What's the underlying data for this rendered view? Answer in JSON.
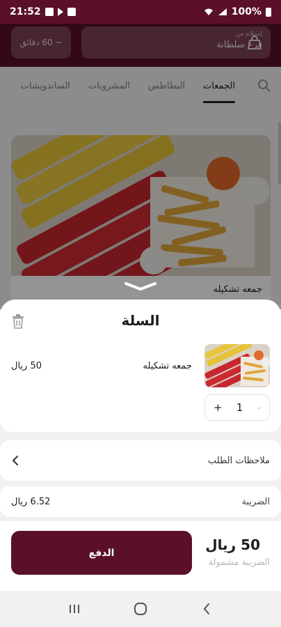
{
  "status_bar": {
    "time": "21:52",
    "battery": "100%"
  },
  "header": {
    "time_chip": "~ 60 دقائق",
    "branch_chip": {
      "line1": "إستلام من",
      "line2": "فرع سلطانة"
    }
  },
  "tabs": [
    {
      "label": "الجمعات",
      "active": true
    },
    {
      "label": "البطاطس",
      "active": false
    },
    {
      "label": "المشروبات",
      "active": false
    },
    {
      "label": "الساندويشات",
      "active": false
    }
  ],
  "product": {
    "name": "جمعه تشكيله"
  },
  "cart": {
    "title": "السلة",
    "item": {
      "name": "جمعه تشكيله",
      "price": "50 ريال",
      "quantity": "1",
      "plus": "+",
      "minus": "-"
    },
    "notes_label": "ملاحظات الطلب",
    "tax_label": "الضريبة",
    "tax_value": "6.52 ريال",
    "total": "50 ريال",
    "total_note": "الضريبة مشمولة",
    "pay_label": "الدفع"
  },
  "colors": {
    "brand": "#5a1029"
  }
}
